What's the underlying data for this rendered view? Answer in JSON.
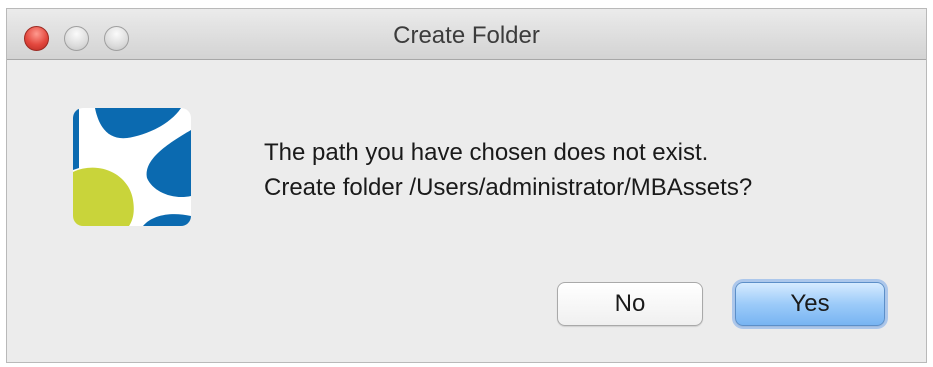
{
  "window": {
    "title": "Create Folder"
  },
  "dialog": {
    "icon": "app-logo-icon",
    "message_line1": "The path you have chosen does not exist.",
    "message_line2": "Create folder /Users/administrator/MBAssets?"
  },
  "buttons": {
    "no_label": "No",
    "yes_label": "Yes",
    "default_button": "Yes"
  },
  "colors": {
    "logo_blue": "#0b6ab0",
    "logo_green": "#c9d43a",
    "default_button_blue": "#78b4f2",
    "close_red": "#e3483e"
  }
}
